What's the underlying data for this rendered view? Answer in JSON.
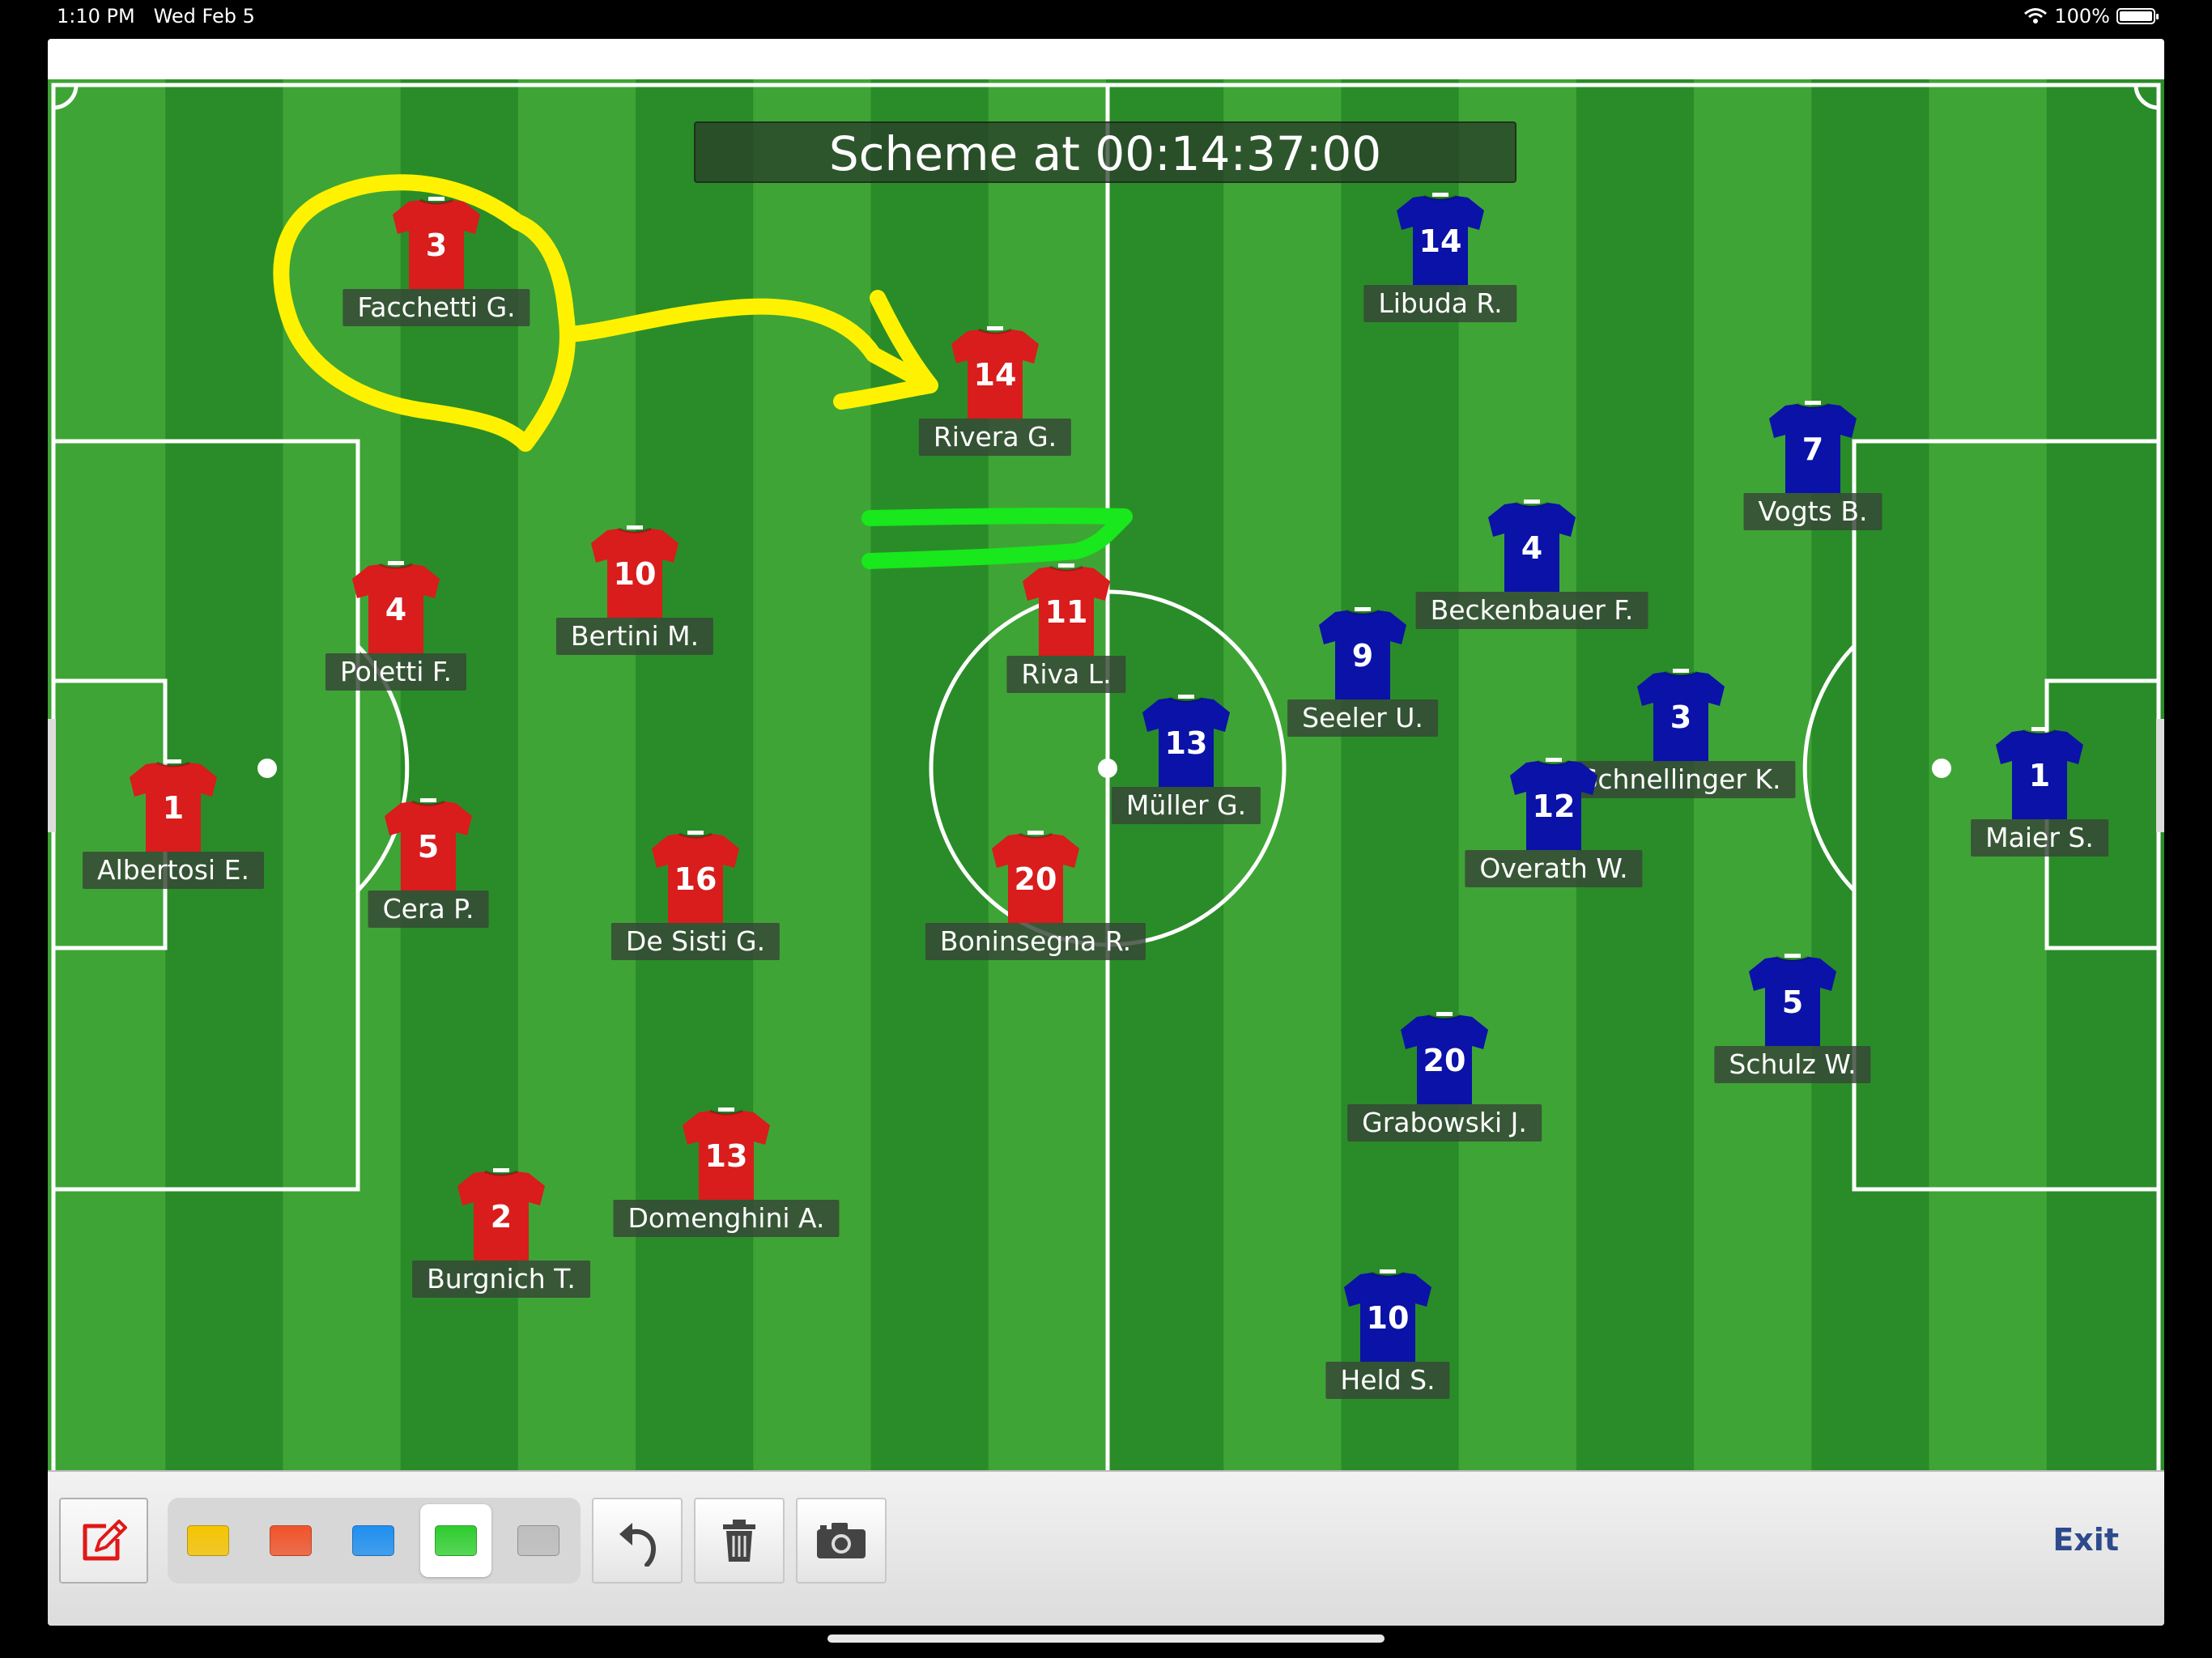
{
  "status_bar": {
    "time": "1:10 PM",
    "date": "Wed Feb 5",
    "battery": "100%",
    "battery_level": 1.0
  },
  "scheme": {
    "title": "Scheme at 00:14:37:00"
  },
  "colors": {
    "red_team": "#d91c1c",
    "blue_team": "#0a12a8",
    "field_light": "#3fa436",
    "field_dark": "#2a8c28",
    "yellow_stroke": "#fff200",
    "green_stroke": "#18e81c"
  },
  "red_team": [
    {
      "number": "1",
      "name": "Albertosi E."
    },
    {
      "number": "3",
      "name": "Facchetti G."
    },
    {
      "number": "4",
      "name": "Poletti F."
    },
    {
      "number": "5",
      "name": "Cera P."
    },
    {
      "number": "2",
      "name": "Burgnich T."
    },
    {
      "number": "10",
      "name": "Bertini M."
    },
    {
      "number": "16",
      "name": "De Sisti G."
    },
    {
      "number": "13",
      "name": "Domenghini A."
    },
    {
      "number": "14",
      "name": "Rivera G."
    },
    {
      "number": "11",
      "name": "Riva L."
    },
    {
      "number": "20",
      "name": "Boninsegna R."
    }
  ],
  "blue_team": [
    {
      "number": "14",
      "name": "Libuda R."
    },
    {
      "number": "13",
      "name": "Müller G."
    },
    {
      "number": "9",
      "name": "Seeler U."
    },
    {
      "number": "4",
      "name": "Beckenbauer F."
    },
    {
      "number": "7",
      "name": "Vogts B."
    },
    {
      "number": "3",
      "name": "Schnellinger K."
    },
    {
      "number": "12",
      "name": "Overath W."
    },
    {
      "number": "1",
      "name": "Maier S."
    },
    {
      "number": "5",
      "name": "Schulz W."
    },
    {
      "number": "20",
      "name": "Grabowski J."
    },
    {
      "number": "10",
      "name": "Held S."
    }
  ],
  "toolbar": {
    "draw_icon": "edit-icon",
    "swatches": [
      {
        "name": "yellow",
        "color": "#f5c400"
      },
      {
        "name": "orange",
        "color": "#f0532a"
      },
      {
        "name": "blue",
        "color": "#1e8ff0"
      },
      {
        "name": "green",
        "color": "#2ecc2e",
        "selected": true
      },
      {
        "name": "gray",
        "color": "#bdbdbd"
      }
    ],
    "undo_icon": "undo-icon",
    "trash_icon": "trash-icon",
    "camera_icon": "camera-icon",
    "exit_label": "Exit"
  }
}
